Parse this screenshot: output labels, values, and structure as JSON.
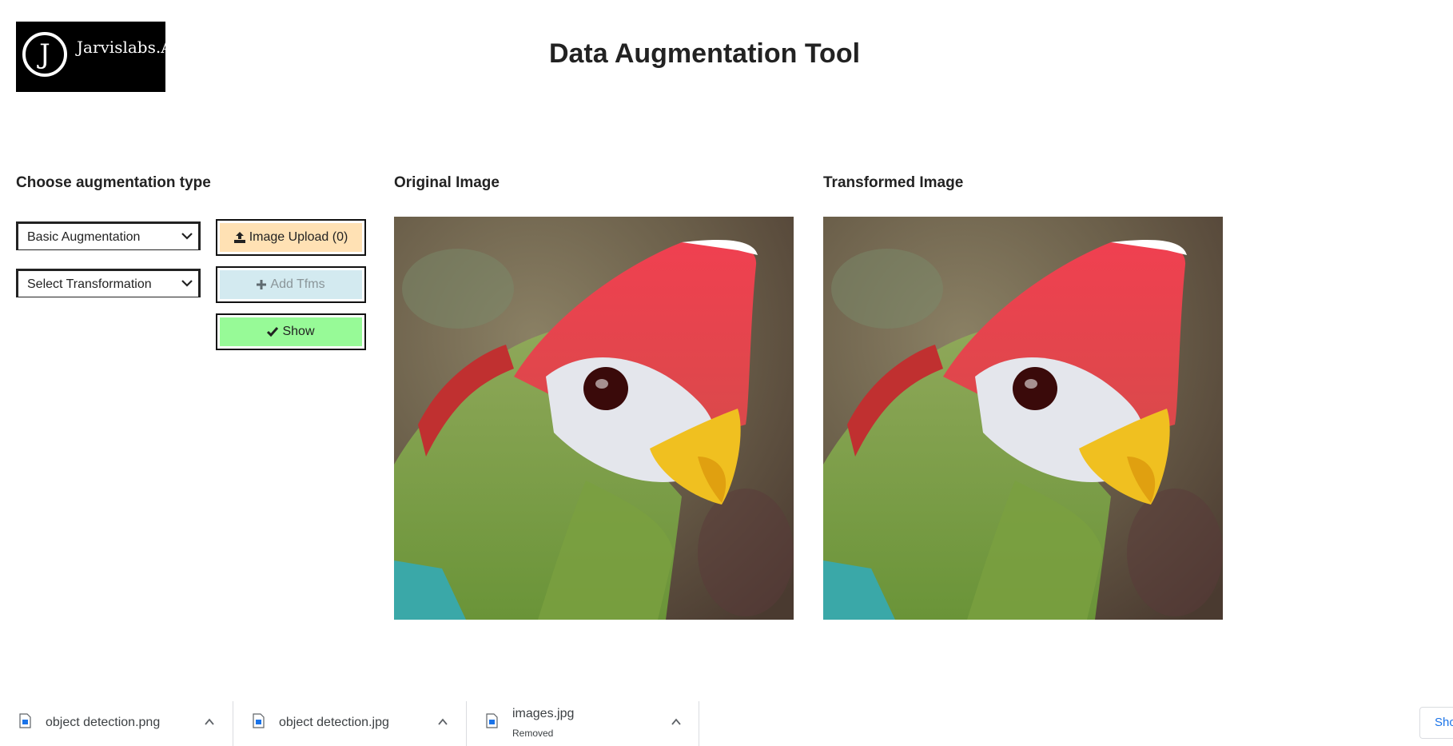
{
  "header": {
    "logo_text": "Jarvislabs.Ai",
    "logo_letter": "J",
    "title": "Data Augmentation Tool"
  },
  "controls": {
    "heading": "Choose augmentation type",
    "augmentation_select": {
      "value": "Basic Augmentation"
    },
    "transformation_select": {
      "value": "Select Transformation"
    },
    "upload_button": {
      "label": "Image Upload (0)",
      "color": "#ffe1b4"
    },
    "add_button": {
      "label": "Add Tfms",
      "color": "#d3eaf0",
      "text_color": "#8a9599"
    },
    "show_button": {
      "label": "Show",
      "color": "#97fa97"
    }
  },
  "panels": {
    "original_heading": "Original Image",
    "transformed_heading": "Transformed Image"
  },
  "downloads": {
    "items": [
      {
        "name": "object detection.png",
        "status": ""
      },
      {
        "name": "object detection.jpg",
        "status": ""
      },
      {
        "name": "images.jpg",
        "status": "Removed"
      }
    ],
    "show_all_label": "Show all"
  }
}
